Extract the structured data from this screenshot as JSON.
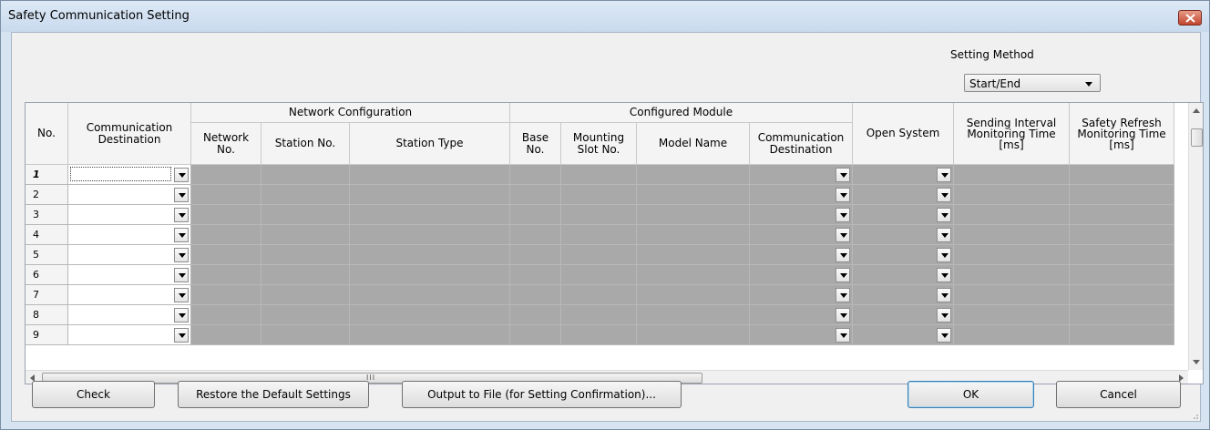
{
  "window": {
    "title": "Safety Communication Setting"
  },
  "setting_method": {
    "label": "Setting Method",
    "value": "Start/End"
  },
  "table": {
    "col_no": "No.",
    "col_comm_dest": "Communication\nDestination",
    "group_network": "Network Configuration",
    "col_network_no": "Network\nNo.",
    "col_station_no": "Station No.",
    "col_station_type": "Station Type",
    "group_module": "Configured Module",
    "col_base_no": "Base\nNo.",
    "col_mount_slot": "Mounting\nSlot No.",
    "col_model_name": "Model Name",
    "col_module_comm_dest": "Communication\nDestination",
    "col_open_system": "Open System",
    "col_send_interval": "Sending Interval\nMonitoring Time\n[ms]",
    "col_safety_refresh": "Safety Refresh\nMonitoring Time\n[ms]",
    "rows": [
      "1",
      "2",
      "3",
      "4",
      "5",
      "6",
      "7",
      "8",
      "9"
    ],
    "selected_row": "1"
  },
  "scrollbar": {
    "grip": "III"
  },
  "buttons": {
    "check": "Check",
    "restore": "Restore the Default Settings",
    "output": "Output to File (for Setting Confirmation)...",
    "ok": "OK",
    "cancel": "Cancel"
  },
  "colors": {
    "disabled_cell": "#a9a9a9",
    "title_bar": "#c9daee",
    "close_button": "#c1452d"
  }
}
